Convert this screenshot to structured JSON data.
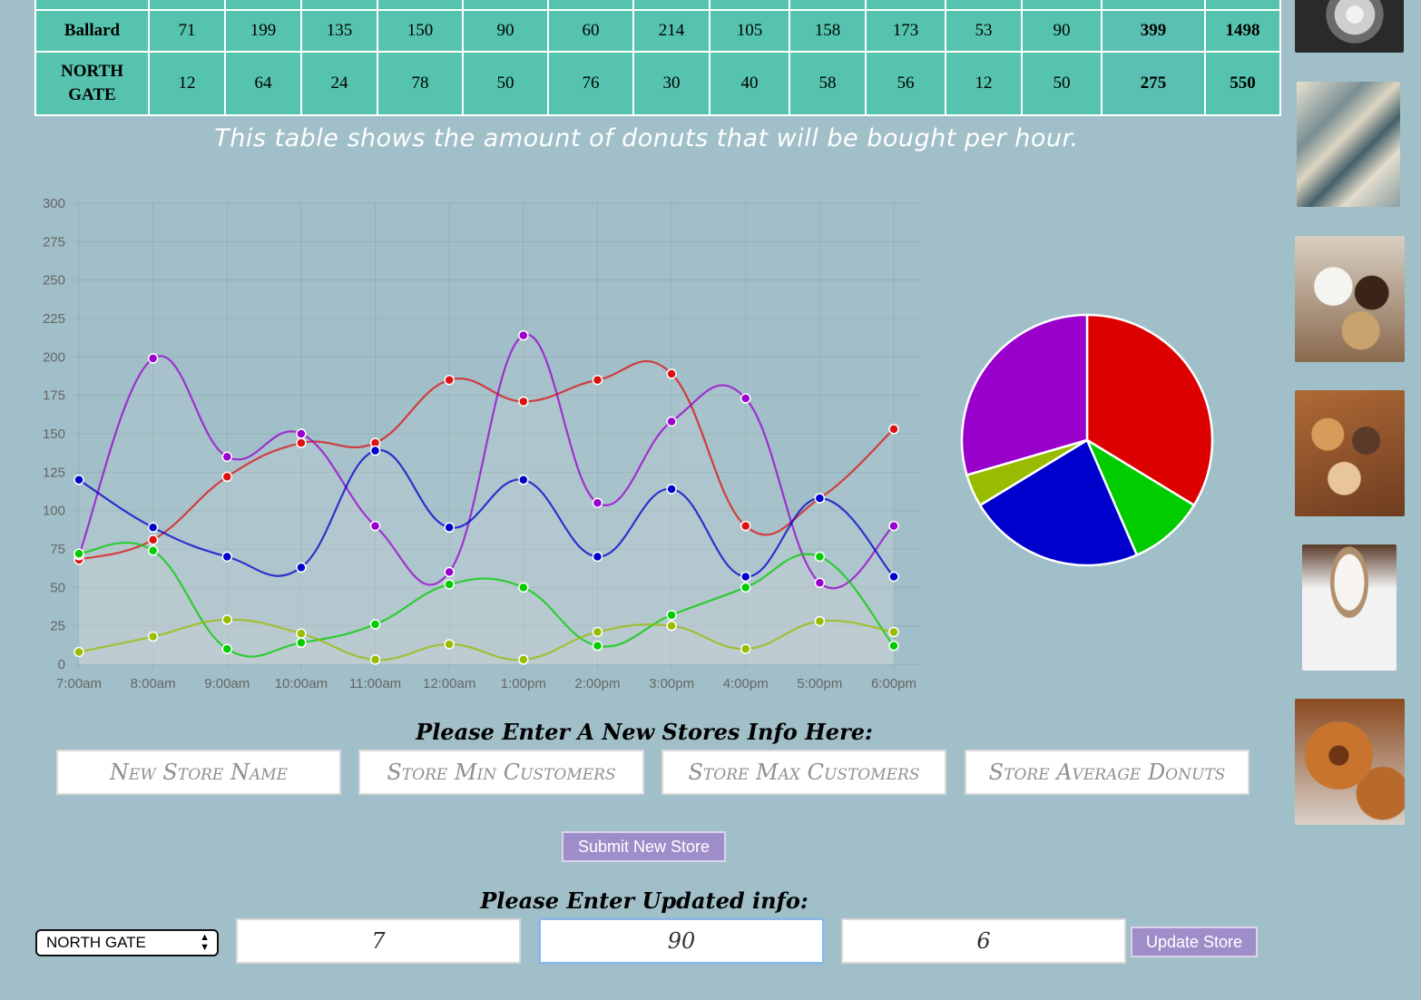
{
  "table": {
    "rows": [
      {
        "store": "Ballard",
        "values": [
          "71",
          "199",
          "135",
          "150",
          "90",
          "60",
          "214",
          "105",
          "158",
          "173",
          "53",
          "90"
        ],
        "daily": "399",
        "total": "1498"
      },
      {
        "store": "NORTH GATE",
        "values": [
          "12",
          "64",
          "24",
          "78",
          "50",
          "76",
          "30",
          "40",
          "58",
          "56",
          "12",
          "50"
        ],
        "daily": "275",
        "total": "550"
      }
    ]
  },
  "caption": "This table shows the amount of donuts that will be bought per hour.",
  "chart_data": [
    {
      "type": "line",
      "x": [
        "7:00am",
        "8:00am",
        "9:00am",
        "10:00am",
        "11:00am",
        "12:00am",
        "1:00pm",
        "2:00pm",
        "3:00pm",
        "4:00pm",
        "5:00pm",
        "6:00pm"
      ],
      "ylim": [
        0,
        300
      ],
      "yticks": [
        0,
        25,
        50,
        75,
        100,
        125,
        150,
        175,
        200,
        225,
        250,
        275,
        300
      ],
      "grid": true,
      "series": [
        {
          "color": "#dd1111",
          "values": [
            68,
            81,
            122,
            144,
            144,
            185,
            171,
            185,
            189,
            90,
            108,
            153
          ]
        },
        {
          "color": "#9a00d0",
          "values": [
            71,
            199,
            135,
            150,
            90,
            60,
            214,
            105,
            158,
            173,
            53,
            90
          ]
        },
        {
          "color": "#0000cc",
          "values": [
            120,
            89,
            70,
            63,
            139,
            89,
            120,
            70,
            114,
            57,
            108,
            57
          ]
        },
        {
          "color": "#00cc00",
          "values": [
            72,
            74,
            10,
            14,
            26,
            52,
            50,
            12,
            32,
            50,
            70,
            12
          ]
        },
        {
          "color": "#99bb00",
          "values": [
            8,
            18,
            29,
            20,
            3,
            13,
            3,
            21,
            25,
            10,
            28,
            21
          ]
        }
      ]
    },
    {
      "type": "pie",
      "slices": [
        {
          "color": "#dd0000",
          "value": 33.7
        },
        {
          "color": "#00cc00",
          "value": 9.8
        },
        {
          "color": "#0000cc",
          "value": 22.8
        },
        {
          "color": "#99bb00",
          "value": 4.2
        },
        {
          "color": "#9900cc",
          "value": 29.5
        }
      ]
    }
  ],
  "new_store_form": {
    "title": "Please Enter A New Stores Info Here:",
    "name_placeholder": "New Store Name",
    "min_placeholder": "Store Min Customers",
    "max_placeholder": "Store Max Customers",
    "avg_placeholder": "Store Average Donuts",
    "submit_label": "Submit New Store"
  },
  "update_form": {
    "title": "Please Enter Updated info:",
    "selected_store": "NORTH GATE",
    "min_value": "7",
    "max_value": "90",
    "avg_value": "6",
    "update_label": "Update Store"
  }
}
